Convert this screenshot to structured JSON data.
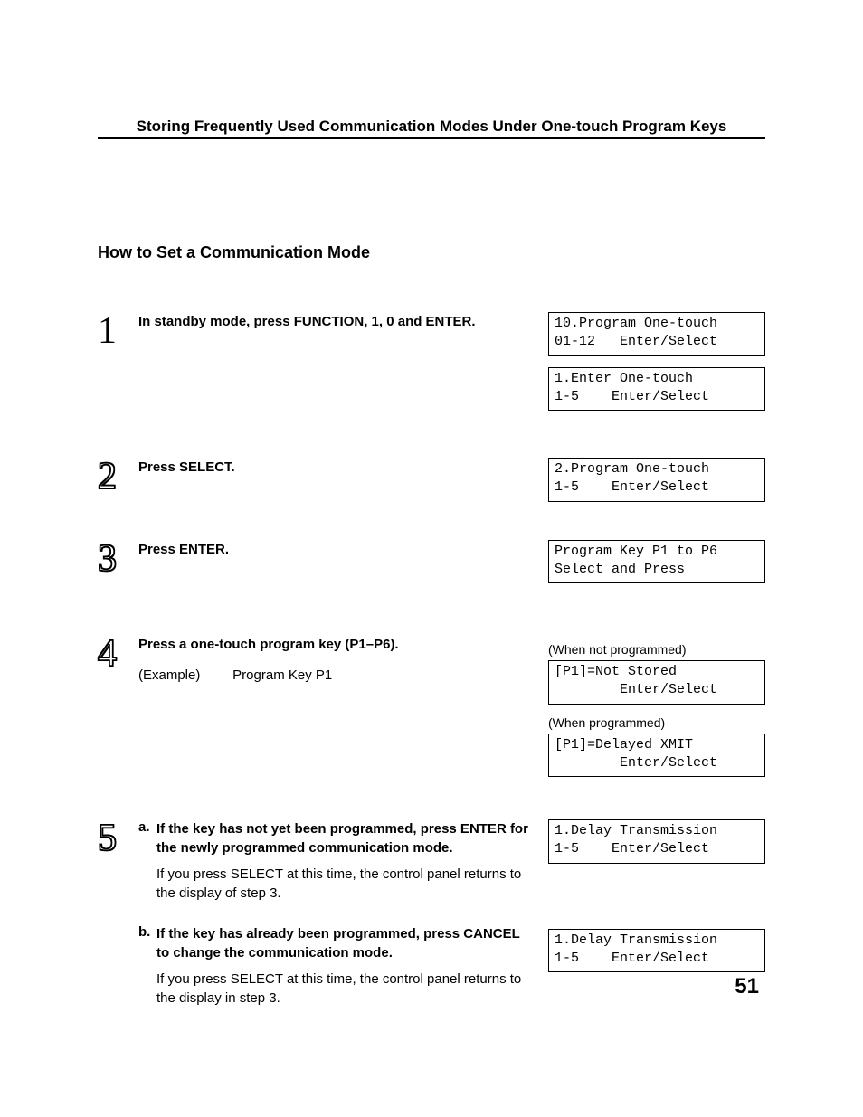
{
  "header": "Storing Frequently Used Communication Modes Under One-touch Program Keys",
  "section_title": "How to Set a Communication Mode",
  "steps": {
    "s1": {
      "num": "1",
      "instr": "In standby mode, press FUNCTION, 1, 0 and ENTER.",
      "display1_l1": "10.Program One-touch",
      "display1_l2": "01-12   Enter/Select",
      "display2_l1": "1.Enter One-touch",
      "display2_l2": "1-5    Enter/Select"
    },
    "s2": {
      "num": "2",
      "instr": "Press SELECT.",
      "display_l1": "2.Program One-touch",
      "display_l2": "1-5    Enter/Select"
    },
    "s3": {
      "num": "3",
      "instr": "Press ENTER.",
      "display_l1": "Program Key P1 to P6",
      "display_l2": "Select and Press"
    },
    "s4": {
      "num": "4",
      "instr": "Press a one-touch program key (P1–P6).",
      "example_label": "(Example)",
      "example_value": "Program Key  P1",
      "caption1": "(When not programmed)",
      "display1_l1": "[P1]=Not Stored",
      "display1_l2": "        Enter/Select",
      "caption2": "(When programmed)",
      "display2_l1": "[P1]=Delayed XMIT",
      "display2_l2": "        Enter/Select"
    },
    "s5": {
      "num": "5",
      "a_letter": "a.",
      "a_title": "If the key has not yet been programmed, press ENTER for the newly programmed communication mode.",
      "a_text": "If you press SELECT at this time, the control panel returns to the display of step 3.",
      "a_display_l1": "1.Delay Transmission",
      "a_display_l2": "1-5    Enter/Select",
      "b_letter": "b.",
      "b_title": "If the key has already been programmed, press CANCEL to change the communication mode.",
      "b_text": "If you press SELECT at this time, the control panel returns to the display in step 3.",
      "b_display_l1": "1.Delay Transmission",
      "b_display_l2": "1-5    Enter/Select"
    }
  },
  "page_number": "51"
}
